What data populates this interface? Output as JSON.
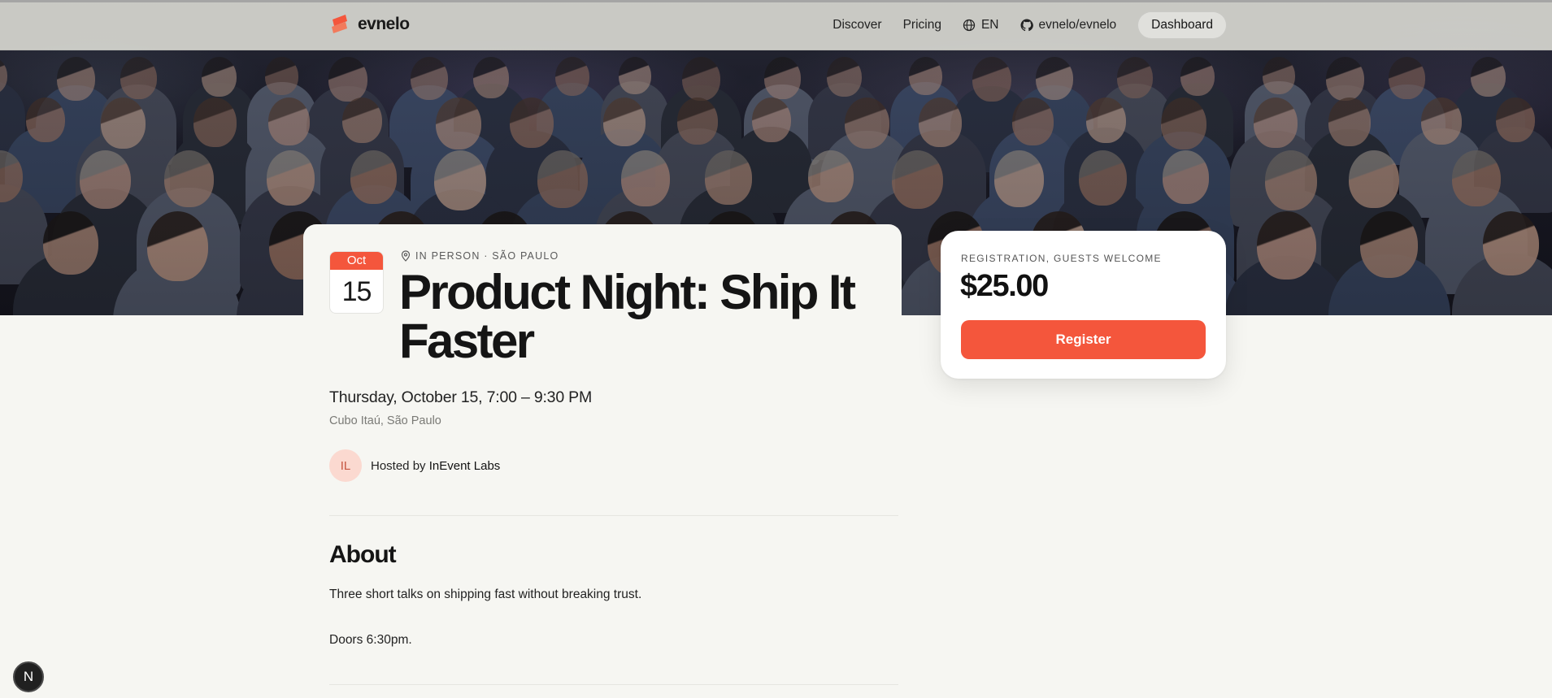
{
  "brand": {
    "name": "evnelo",
    "accent_color": "#f4563c"
  },
  "nav": {
    "discover": "Discover",
    "pricing": "Pricing",
    "language": "EN",
    "repo": "evnelo/evnelo",
    "dashboard": "Dashboard"
  },
  "event": {
    "month": "Oct",
    "day": "15",
    "meta": "IN PERSON · SÃO PAULO",
    "title": "Product Night: Ship It Faster",
    "datetime": "Thursday, October 15, 7:00 – 9:30 PM",
    "venue": "Cubo Itaú, São Paulo",
    "host_initials": "IL",
    "host_prefix": "Hosted by",
    "host_name": "InEvent Labs"
  },
  "about": {
    "heading": "About",
    "paragraphs": [
      "Three short talks on shipping fast without breaking trust.",
      "Doors 6:30pm."
    ]
  },
  "registration": {
    "label": "REGISTRATION, GUESTS WELCOME",
    "price": "$25.00",
    "button": "Register"
  },
  "dev_badge": {
    "letter": "N"
  }
}
